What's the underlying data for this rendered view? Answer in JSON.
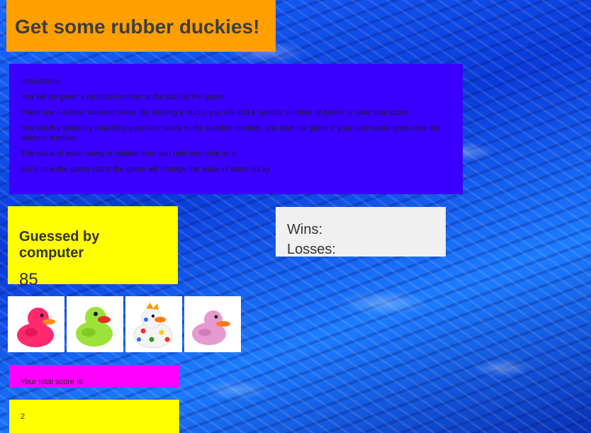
{
  "title": "Get some rubber duckies!",
  "instructions": {
    "heading": "Instructions:",
    "lines": [
      "You will be given a random number at the start of the game.",
      "There are 4 rubber duckies below. By clicking a ducky you will add a specific number of points to your total score.",
      "You win the game by matching your total score to the random number; you lose the game if your total score goes over the random number.",
      "The value of each ducky is hidden from you until you click on it.",
      "Each time the game starts the game will change the value of each ducky."
    ]
  },
  "guess": {
    "label": "Guessed by computer",
    "value": "85"
  },
  "record": {
    "wins_label": "Wins:",
    "losses_label": "Losses:"
  },
  "duckies": [
    {
      "icon": "pink-rubber-duck-icon",
      "color": "#ff2a6d"
    },
    {
      "icon": "green-rubber-duck-icon",
      "color": "#9be33a"
    },
    {
      "icon": "polka-dot-rubber-duck-icon",
      "color": "#ffffff"
    },
    {
      "icon": "light-pink-rubber-duck-icon",
      "color": "#e79ad0"
    }
  ],
  "score": {
    "label": "Your total score is:",
    "value": "2"
  },
  "colors": {
    "title_bg": "#ff9f00",
    "instructions_bg": "#3a00ff",
    "guess_bg": "#ffff00",
    "record_bg": "#f0f0f0",
    "score_label_bg": "#ff00ff",
    "score_value_bg": "#ffff00"
  }
}
